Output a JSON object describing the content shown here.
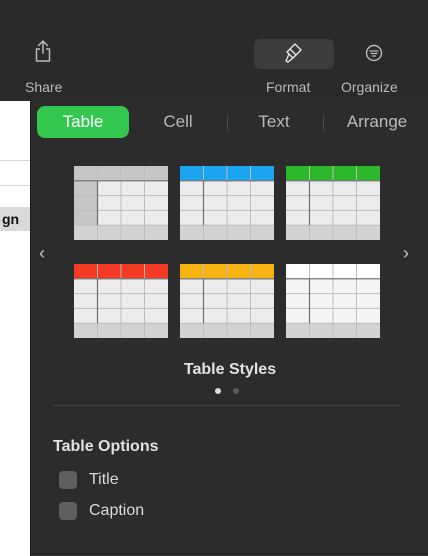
{
  "toolbar": {
    "share_label": "Share",
    "format_label": "Format",
    "organize_label": "Organize"
  },
  "document": {
    "visible_fragment": "gn"
  },
  "tabs": [
    {
      "label": "Table",
      "active": true
    },
    {
      "label": "Cell",
      "active": false
    },
    {
      "label": "Text",
      "active": false
    },
    {
      "label": "Arrange",
      "active": false
    }
  ],
  "table_styles": {
    "label": "Table Styles",
    "page_count": 2,
    "current_page": 1,
    "styles": [
      {
        "header": "#c6c6c6",
        "body": "#ececec",
        "headerColumn": true
      },
      {
        "header": "#1aa3ee",
        "body": "#ececec",
        "headerColumn": false
      },
      {
        "header": "#2bb82b",
        "body": "#ececec",
        "headerColumn": false
      },
      {
        "header": "#f33a22",
        "body": "#ececec",
        "headerColumn": false
      },
      {
        "header": "#f6b311",
        "body": "#ececec",
        "headerColumn": false
      },
      {
        "header": "#ffffff",
        "body": "#f4f4f4",
        "headerColumn": false
      }
    ]
  },
  "table_options": {
    "title": "Table Options",
    "options": [
      {
        "label": "Title",
        "checked": false
      },
      {
        "label": "Caption",
        "checked": false
      }
    ]
  },
  "colors": {
    "accent": "#33c74f",
    "panel_bg": "#2c2c2c",
    "toolbar_bg": "#2a2a2a",
    "text_dim": "#b9b9b9"
  },
  "icons": {
    "share": "share-icon",
    "format": "paintbrush-icon",
    "organize": "organize-icon",
    "prev": "chevron-left-icon",
    "next": "chevron-right-icon"
  }
}
